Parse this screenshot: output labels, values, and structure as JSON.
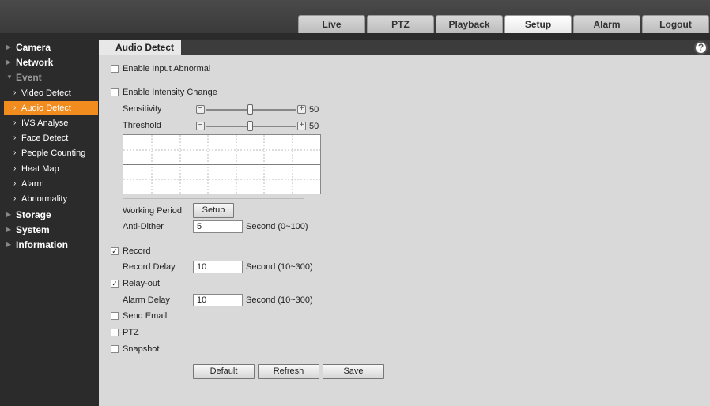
{
  "top_tabs": [
    {
      "label": "Live",
      "active": false
    },
    {
      "label": "PTZ",
      "active": false
    },
    {
      "label": "Playback",
      "active": false
    },
    {
      "label": "Setup",
      "active": true
    },
    {
      "label": "Alarm",
      "active": false
    },
    {
      "label": "Logout",
      "active": false
    }
  ],
  "sidebar": {
    "camera": "Camera",
    "network": "Network",
    "event": "Event",
    "event_items": [
      "Video Detect",
      "Audio Detect",
      "IVS Analyse",
      "Face Detect",
      "People Counting",
      "Heat Map",
      "Alarm",
      "Abnormality"
    ],
    "selected": "Audio Detect",
    "storage": "Storage",
    "system": "System",
    "information": "Information"
  },
  "page": {
    "tab": "Audio Detect",
    "enable_input_abnormal": {
      "label": "Enable Input Abnormal",
      "checked": false
    },
    "enable_intensity_change": {
      "label": "Enable Intensity Change",
      "checked": false
    },
    "sensitivity": {
      "label": "Sensitivity",
      "value": "50"
    },
    "threshold": {
      "label": "Threshold",
      "value": "50"
    },
    "working_period": {
      "label": "Working Period",
      "button": "Setup"
    },
    "anti_dither": {
      "label": "Anti-Dither",
      "value": "5",
      "unit": "Second (0~100)"
    },
    "record": {
      "label": "Record",
      "checked": true
    },
    "record_delay": {
      "label": "Record Delay",
      "value": "10",
      "unit": "Second (10~300)"
    },
    "relay_out": {
      "label": "Relay-out",
      "checked": true
    },
    "alarm_delay": {
      "label": "Alarm Delay",
      "value": "10",
      "unit": "Second (10~300)"
    },
    "send_email": {
      "label": "Send Email",
      "checked": false
    },
    "ptz": {
      "label": "PTZ",
      "checked": false
    },
    "snapshot": {
      "label": "Snapshot",
      "checked": false
    },
    "buttons": {
      "default": "Default",
      "refresh": "Refresh",
      "save": "Save"
    }
  },
  "icons": {
    "help": "help-icon",
    "check": "✓",
    "minus": "−",
    "plus": "+"
  },
  "colors": {
    "accent": "#f28c1e",
    "sidebar_bg": "#2b2b2b",
    "content_bg": "#d9d9d9"
  }
}
